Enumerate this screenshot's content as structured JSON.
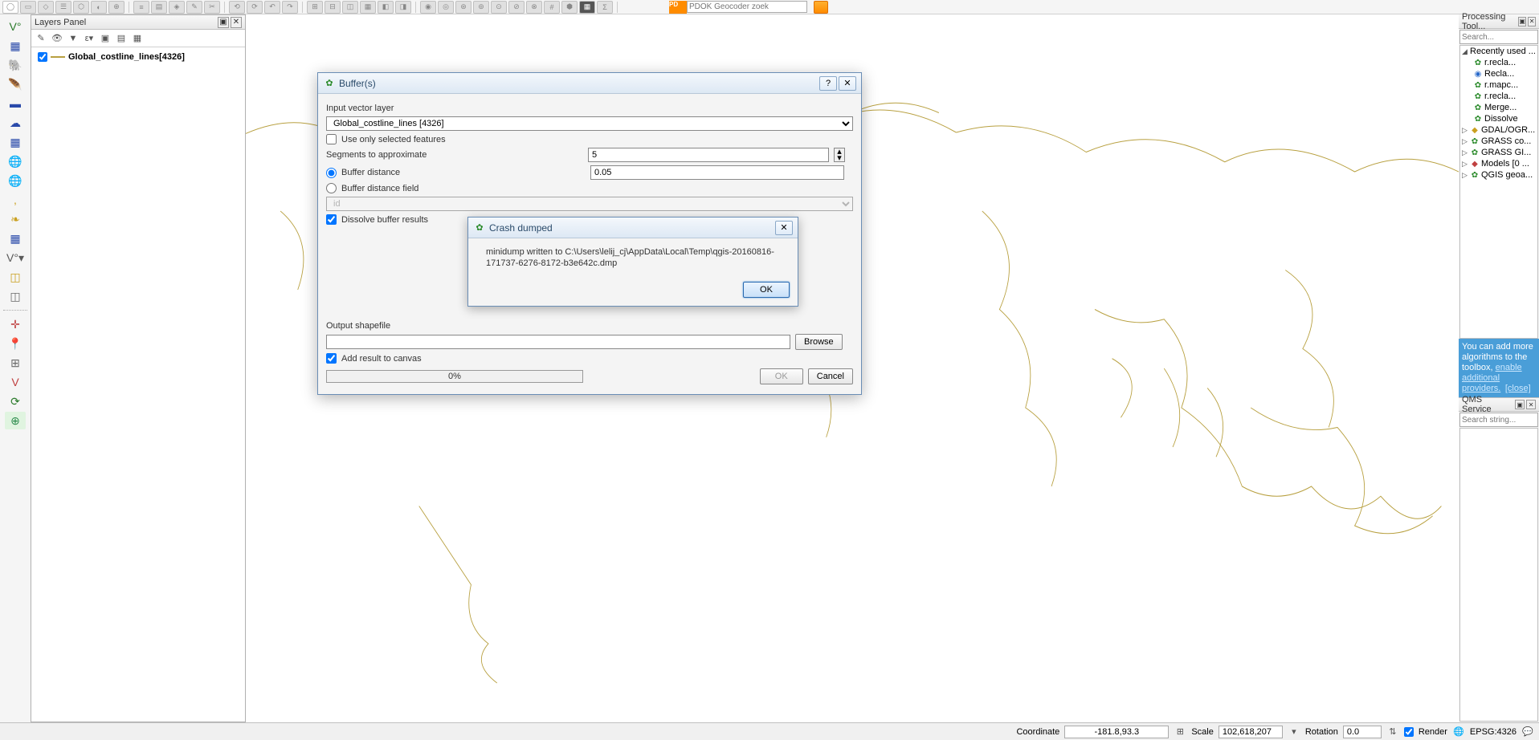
{
  "top_toolbar": {
    "pdok_geocoder_label": "PDOK Geocoder zoek"
  },
  "layers_panel": {
    "title": "Layers Panel",
    "layer_name": "Global_costline_lines[4326]"
  },
  "processing_panel": {
    "title": "Processing Tool...",
    "search_placeholder": "Search...",
    "recent_label": "Recently used ...",
    "recent_items": [
      "r.recla...",
      "Recla...",
      "r.mapc...",
      "r.recla...",
      "Merge...",
      "Dissolve"
    ],
    "groups": [
      "GDAL/OGR...",
      "GRASS co...",
      "GRASS GI...",
      "Models [0 ...",
      "QGIS geoa..."
    ],
    "hint_text1": "You can add more algorithms to the toolbox, ",
    "hint_link1": "enable additional providers.",
    "hint_close": "[close]"
  },
  "qms": {
    "title": "QMS Service",
    "search_placeholder": "Search string..."
  },
  "buffer_dialog": {
    "title": "Buffer(s)",
    "input_label": "Input vector layer",
    "input_value": "Global_costline_lines [4326]",
    "use_selected": "Use only selected features",
    "segments_label": "Segments to approximate",
    "segments_value": "5",
    "buffer_distance_label": "Buffer distance",
    "buffer_distance_value": "0.05",
    "buffer_field_label": "Buffer distance field",
    "buffer_field_value": "id",
    "dissolve_label": "Dissolve buffer results",
    "output_label": "Output shapefile",
    "browse": "Browse",
    "add_canvas": "Add result to canvas",
    "progress": "0%",
    "ok": "OK",
    "cancel": "Cancel"
  },
  "crash_dialog": {
    "title": "Crash dumped",
    "message": "minidump written to C:\\Users\\lelij_cj\\AppData\\Local\\Temp\\qgis-20160816-171737-6276-8172-b3e642c.dmp",
    "ok": "OK"
  },
  "status": {
    "coordinate_label": "Coordinate",
    "coordinate_value": "-181.8,93.3",
    "scale_label": "Scale",
    "scale_value": "102,618,207",
    "rotation_label": "Rotation",
    "rotation_value": "0.0",
    "render_label": "Render",
    "crs_label": "EPSG:4326"
  }
}
